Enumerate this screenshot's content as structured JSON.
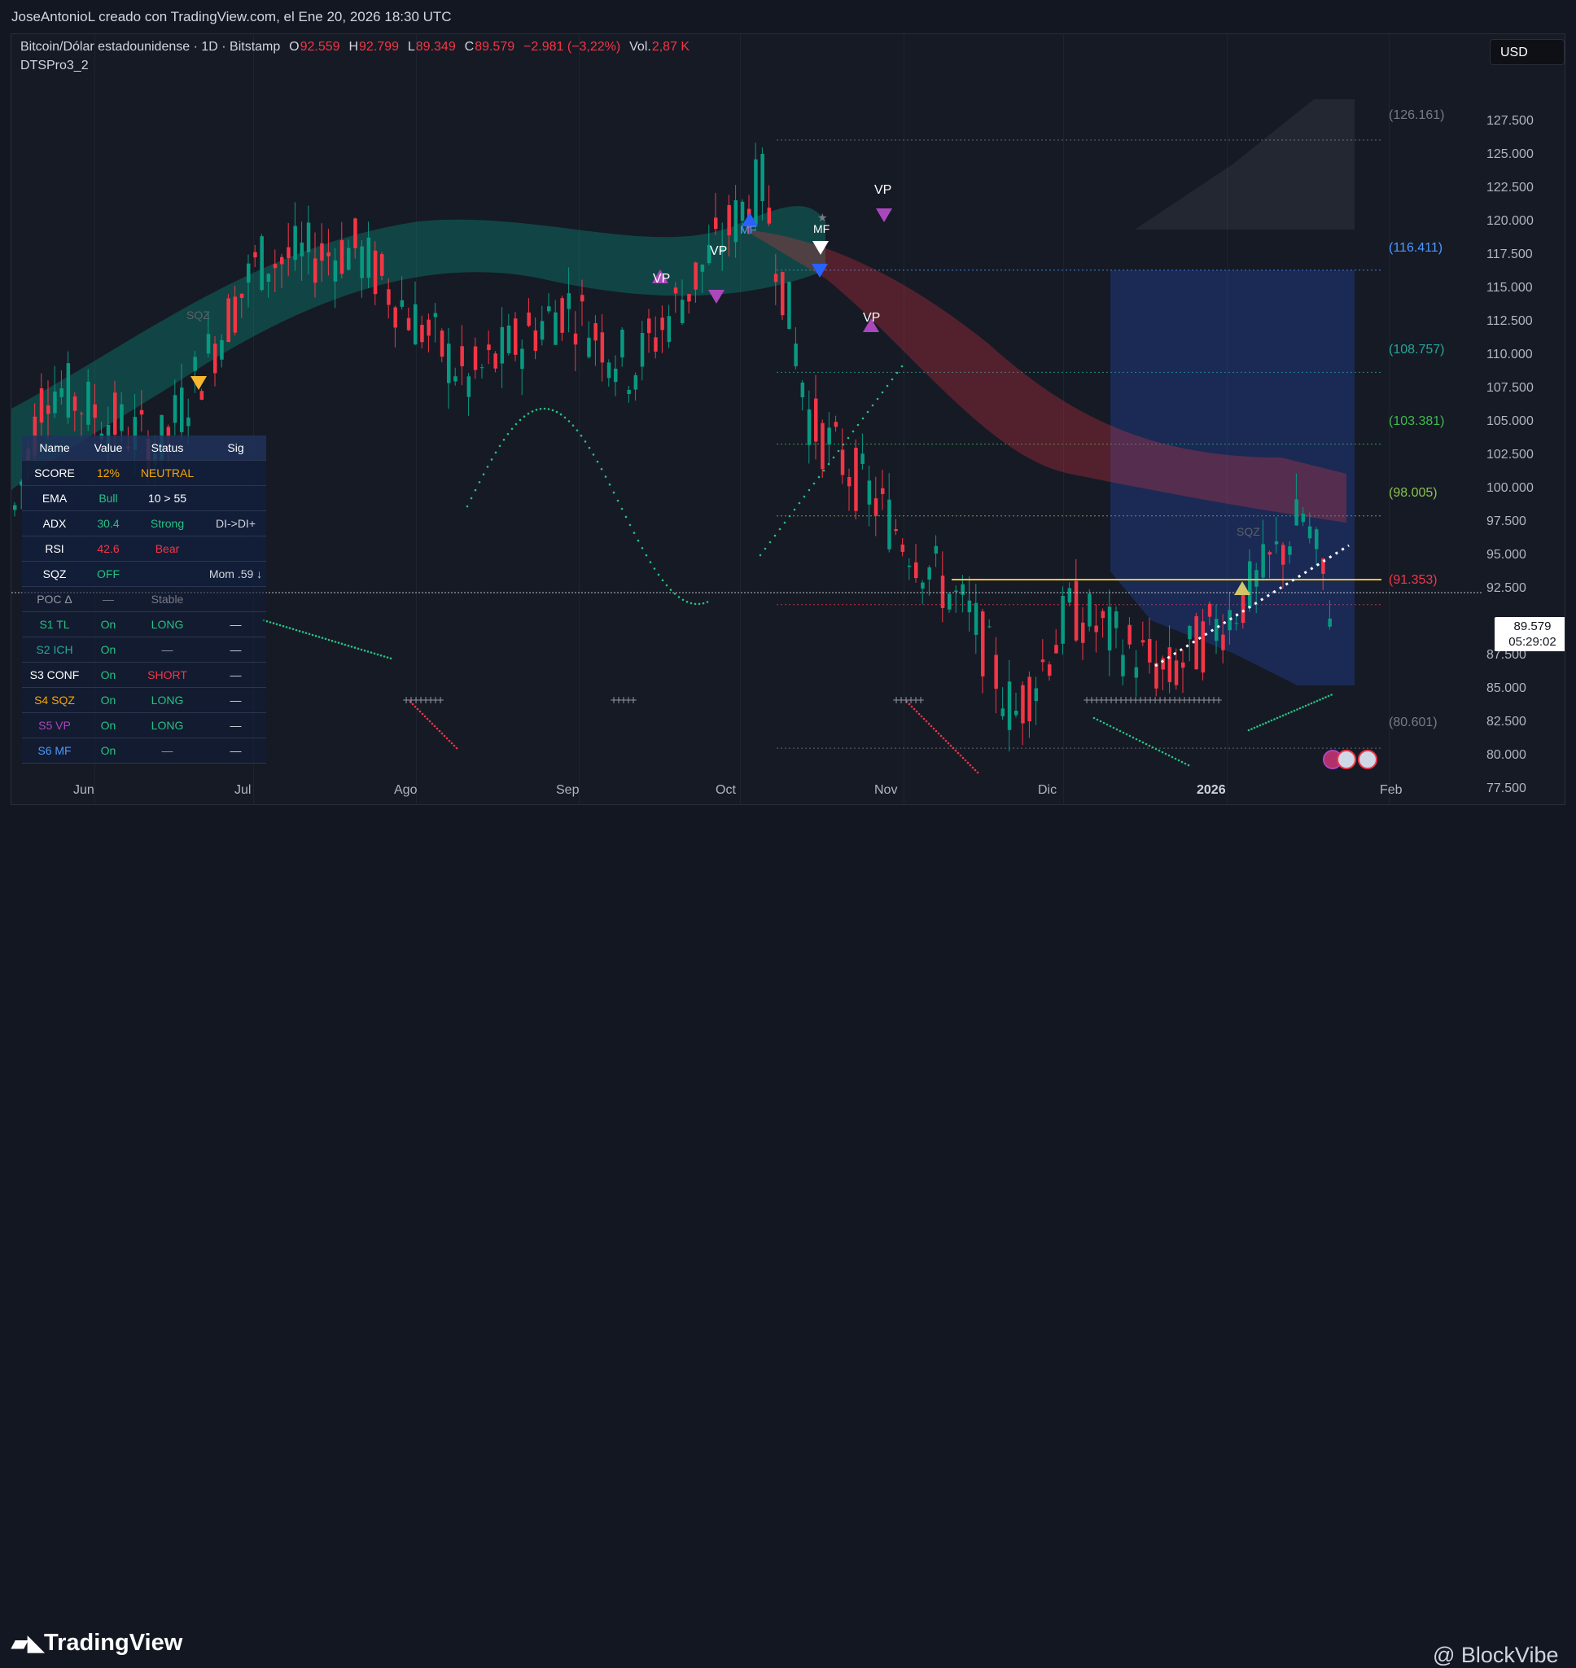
{
  "header": {
    "credit": "JoseAntonioL creado con TradingView.com, el Ene 20, 2026 18:30 UTC"
  },
  "legend": {
    "symbol": "Bitcoin/Dólar estadounidense · 1D · Bitstamp",
    "o_label": "O",
    "o_value": "92.559",
    "h_label": "H",
    "h_value": "92.799",
    "l_label": "L",
    "l_value": "89.349",
    "c_label": "C",
    "c_value": "89.579",
    "change": "−2.981 (−3,22%)",
    "vol_label": "Vol.",
    "vol_value": "2,87 K",
    "indicator": "DTSPro3_2"
  },
  "currency_button": "USD",
  "y_axis": [
    "127.500",
    "125.000",
    "122.500",
    "120.000",
    "117.500",
    "115.000",
    "112.500",
    "110.000",
    "107.500",
    "105.000",
    "102.500",
    "100.000",
    "97.500",
    "95.000",
    "92.500",
    "87.500",
    "85.000",
    "82.500",
    "80.000",
    "77.500"
  ],
  "x_axis": [
    "Jun",
    "Jul",
    "Ago",
    "Sep",
    "Oct",
    "Nov",
    "Dic",
    "2026",
    "Feb"
  ],
  "levels": [
    {
      "label": "(126.161)",
      "color": "#787b86"
    },
    {
      "label": "(116.411)",
      "color": "#4c9aff"
    },
    {
      "label": "(108.757)",
      "color": "#26a69a"
    },
    {
      "label": "(103.381)",
      "color": "#3fb950"
    },
    {
      "label": "(98.005)",
      "color": "#8bc34a"
    },
    {
      "label": "(91.353)",
      "color": "#f23645"
    },
    {
      "label": "(80.601)",
      "color": "#787b86"
    }
  ],
  "price_box": {
    "price": "89.579",
    "countdown": "05:29:02"
  },
  "markers": {
    "vp": "VP",
    "mf": "MF",
    "sqz": "SQZ"
  },
  "table": {
    "headers": [
      "Name",
      "Value",
      "Status",
      "Sig"
    ],
    "rows": [
      {
        "name": "SCORE",
        "value": "12%",
        "status": "NEUTRAL",
        "sig": "",
        "name_color": "#ffffff",
        "value_color": "#f7a600",
        "status_color": "#f7a600"
      },
      {
        "name": "EMA",
        "value": "Bull",
        "status": "10 > 55",
        "sig": "",
        "name_color": "#ffffff",
        "value_color": "#26c281",
        "status_color": "#ffffff"
      },
      {
        "name": "ADX",
        "value": "30.4",
        "status": "Strong",
        "sig": "DI->DI+",
        "name_color": "#ffffff",
        "value_color": "#26c281",
        "status_color": "#26c281"
      },
      {
        "name": "RSI",
        "value": "42.6",
        "status": "Bear",
        "sig": "",
        "name_color": "#ffffff",
        "value_color": "#f23645",
        "status_color": "#f23645"
      },
      {
        "name": "SQZ",
        "value": "OFF",
        "status": "",
        "sig": "Mom .59 ↓",
        "name_color": "#ffffff",
        "value_color": "#26c281",
        "status_color": "#ffffff"
      },
      {
        "name": "POC Δ",
        "value": "—",
        "status": "Stable",
        "sig": "",
        "name_color": "#9598a1",
        "value_color": "#787b86",
        "status_color": "#787b86"
      },
      {
        "name": "S1 TL",
        "value": "On",
        "status": "LONG",
        "sig": "—",
        "name_color": "#26c281",
        "value_color": "#26c281",
        "status_color": "#26c281"
      },
      {
        "name": "S2 ICH",
        "value": "On",
        "status": "—",
        "sig": "—",
        "name_color": "#26a69a",
        "value_color": "#26c281",
        "status_color": "#9598a1"
      },
      {
        "name": "S3 CONF",
        "value": "On",
        "status": "SHORT",
        "sig": "—",
        "name_color": "#ffffff",
        "value_color": "#26c281",
        "status_color": "#f23645"
      },
      {
        "name": "S4 SQZ",
        "value": "On",
        "status": "LONG",
        "sig": "—",
        "name_color": "#f7a600",
        "value_color": "#26c281",
        "status_color": "#26c281"
      },
      {
        "name": "S5 VP",
        "value": "On",
        "status": "LONG",
        "sig": "—",
        "name_color": "#ab47bc",
        "value_color": "#26c281",
        "status_color": "#26c281"
      },
      {
        "name": "S6 MF",
        "value": "On",
        "status": "—",
        "sig": "—",
        "name_color": "#4c9aff",
        "value_color": "#26c281",
        "status_color": "#9598a1"
      }
    ]
  },
  "footer": {
    "tv_logo": "TradingView",
    "brand": "@ BlockVibe"
  },
  "colors": {
    "up": "#089981",
    "down": "#f23645",
    "accent": "#2962ff",
    "poc": "#f7c52b"
  }
}
